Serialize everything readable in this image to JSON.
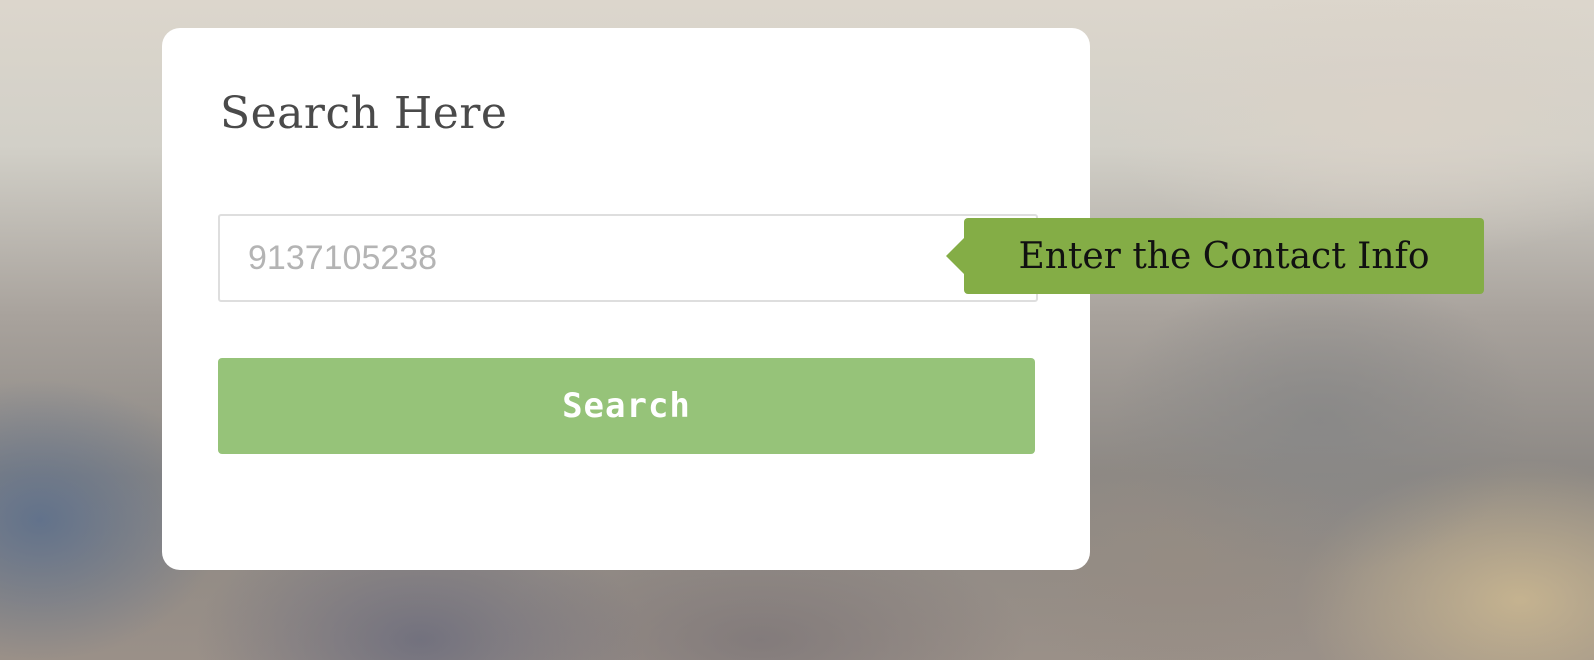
{
  "form": {
    "title": "Search Here",
    "search_input": {
      "value": "9137105238"
    },
    "tooltip": "Enter the Contact Info",
    "search_button_label": "Search"
  },
  "colors": {
    "tooltip_bg": "#84ad46",
    "button_bg": "#96c379",
    "card_bg": "#ffffff",
    "title_text": "#4a4a4a",
    "input_text": "#b4b4b4"
  }
}
